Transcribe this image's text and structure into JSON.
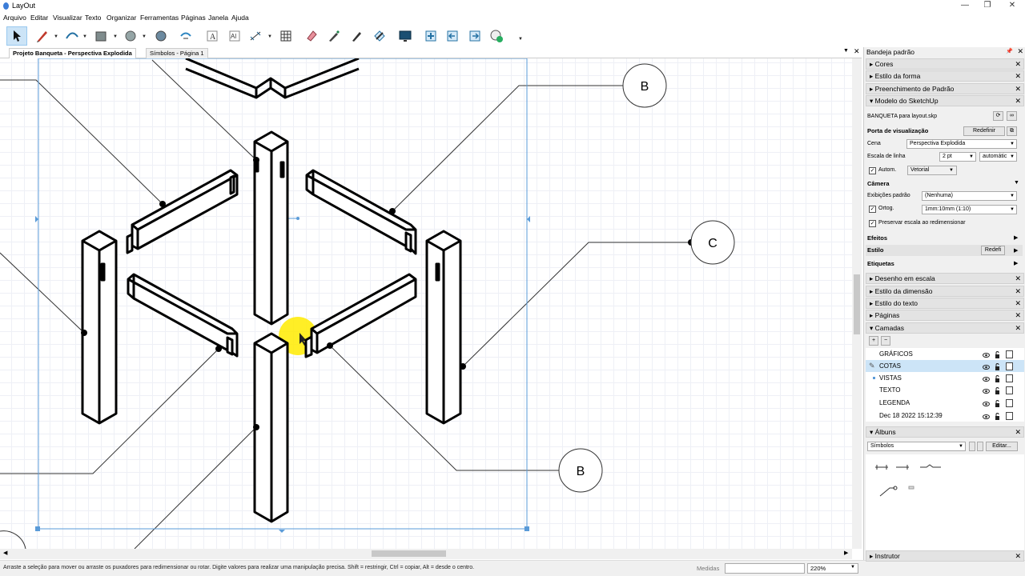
{
  "window": {
    "title": "LayOut",
    "minimize": "—",
    "restore": "❐",
    "close": "✕"
  },
  "menu": [
    "Arquivo",
    "Editar",
    "Visualizar",
    "Texto",
    "Organizar",
    "Ferramentas",
    "Páginas",
    "Janela",
    "Ajuda"
  ],
  "toolbar": {
    "icons": [
      "select-arrow-icon",
      "pencil-line-icon",
      "arc-icon",
      "shape-rect-icon",
      "circle-icon",
      "polygon-icon",
      "offset-icon",
      "text-icon",
      "label-icon",
      "dimension-icon",
      "table-icon",
      "eraser-icon",
      "eyedropper-icon",
      "paint-style-icon",
      "join-icon",
      "presentation-icon",
      "add-page-icon",
      "prev-page-icon",
      "next-page-icon",
      "user-status-icon"
    ]
  },
  "tabs": [
    {
      "label": "Projeto Banqueta - Perspectiva Explodida",
      "active": true
    },
    {
      "label": "Símbolos - Página 1",
      "active": false
    }
  ],
  "canvas": {
    "callouts": [
      "B",
      "C",
      "B"
    ],
    "frame_color": "#5a9bd8",
    "highlight_color": "#ffeb00"
  },
  "status": {
    "message": "Arraste a seleção para mover ou arraste os puxadores para redimensionar ou rotar. Digite valores para realizar uma manipulação precisa. Shift = restringir, Ctrl = copiar, Alt = desde o centro.",
    "measure_label": "Medidas",
    "measure_value": "",
    "zoom": "220%"
  },
  "tray": {
    "title": "Bandeja padrão",
    "sections_top": [
      "Cores",
      "Estilo da forma",
      "Preenchimento de Padrão"
    ],
    "model": {
      "header": "Modelo do SketchUp",
      "file": "BANQUETA para layout.skp",
      "viewport_label": "Porta de visualização",
      "reset_button": "Redefinir",
      "scene_label": "Cena",
      "scene_value": "Perspectiva Explodida",
      "line_scale_label": "Escala de linha",
      "line_scale_value": "2 pt",
      "auto_value": "automátic",
      "autom_label": "Autom.",
      "render_value": "Vetorial",
      "camera_label": "Câmera",
      "standard_views_label": "Exibições padrão",
      "standard_views_value": "(Nenhuma)",
      "ortho_label": "Ortog.",
      "ortho_value": "1mm:10mm (1:10)",
      "preserve_label": "Preservar escala ao redimensionar",
      "effects_label": "Efeitos",
      "style_label": "Estilo",
      "style_button": "Redefi",
      "tags_label": "Etiquetas"
    },
    "sections_mid": [
      "Desenho em escala",
      "Estilo da dimensão",
      "Estilo do texto",
      "Páginas"
    ],
    "layers": {
      "header": "Camadas",
      "add": "+",
      "remove": "−",
      "items": [
        {
          "name": "GRÁFICOS",
          "selected": false
        },
        {
          "name": "COTAS",
          "selected": true
        },
        {
          "name": "VISTAS",
          "selected": false
        },
        {
          "name": "TEXTO",
          "selected": false
        },
        {
          "name": "LEGENDA",
          "selected": false
        },
        {
          "name": "Dec 18 2022 15:12:39",
          "selected": false
        }
      ]
    },
    "albums": {
      "header": "Álbuns",
      "value": "Símbolos",
      "edit": "Editar..."
    },
    "instructor": "Instrutor"
  }
}
